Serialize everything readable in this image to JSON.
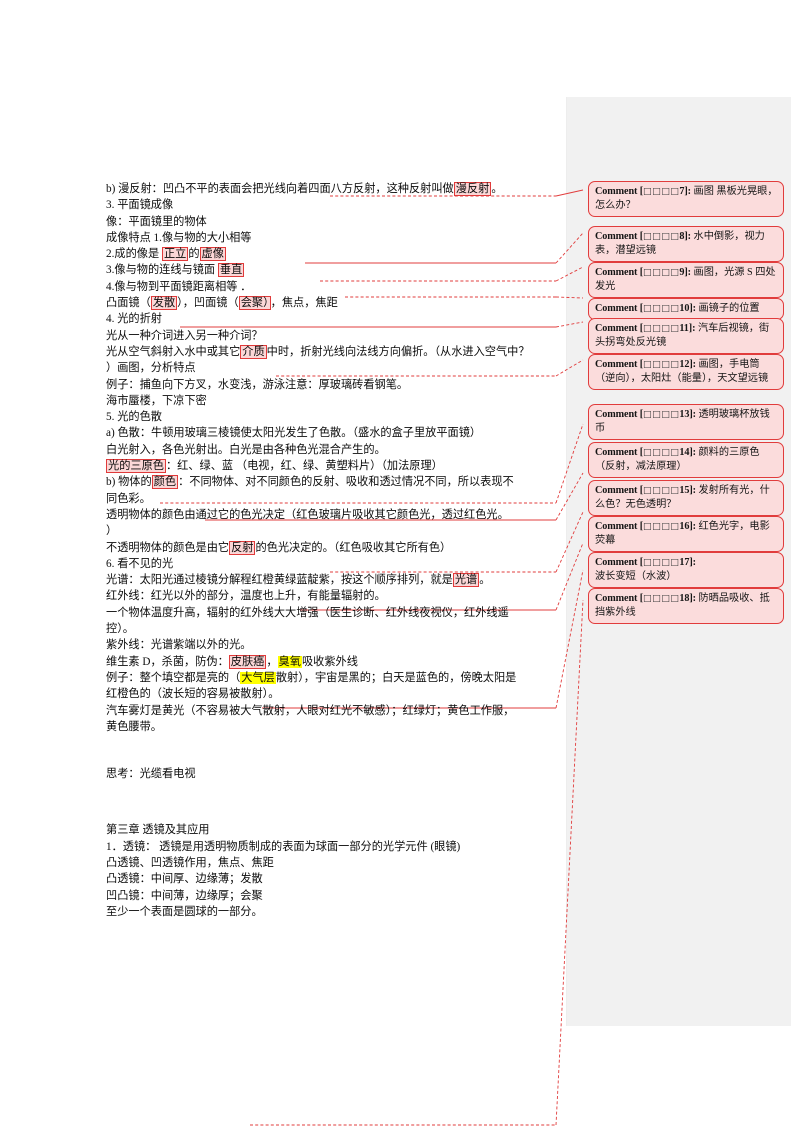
{
  "document": {
    "page_background": "#ffffff",
    "margin_panel_color": "#f1f1f1",
    "comment_fill": "#fbdcdc",
    "comment_border": "#e13c3c",
    "anchor_highlight_fill": "#fbd7d7",
    "yellow_highlight": "#ffff00"
  },
  "body": {
    "lines": [
      {
        "indent": 2,
        "text": "b)    漫反射：凹凸不平的表面会把光线向着四面八方反射，这种反射叫做",
        "hl": "漫反射",
        "tail": "。"
      },
      {
        "indent": 1,
        "text": "3.    平面镜成像"
      },
      {
        "indent": 3,
        "text": "像：平面镜里的物体"
      },
      {
        "indent": 1,
        "text": " 成像特点 1.像与物的大小相等"
      },
      {
        "indent": 4,
        "text": "2.成的像是 ",
        "hl": "正立",
        "mid": "的",
        "hl2": "虚像"
      },
      {
        "indent": 5,
        "text": "3.像与物的连线与镜面 ",
        "hl": "垂直"
      },
      {
        "indent": 5,
        "text": "4.像与物到平面镜距离相等 ．"
      },
      {
        "indent": 3,
        "text": "凸面镜（",
        "hl": "发散",
        "mid": "），凹面镜（",
        "hl2": "会聚）",
        "tail": "，焦点，焦距"
      },
      {
        "indent": 1,
        "text": "4.    光的折射"
      },
      {
        "indent": 3,
        "text": "光从一种介词进入另一种介词？"
      },
      {
        "indent": 3,
        "text": "光从空气斜射入水中或其它",
        "hl": "介质",
        "tail": "中时，折射光线向法线方向偏折。（从水进入空气中？"
      },
      {
        "indent": 3,
        "text": "）画图，分析特点"
      },
      {
        "indent": 1,
        "text": "例子：捕鱼向下方叉，水变浅，游泳注意：厚玻璃砖看钢笔。"
      },
      {
        "indent": 1,
        "text": "海市蜃楼，下凉下密"
      },
      {
        "indent": 1,
        "text": "5.    光的色散"
      },
      {
        "indent": 2,
        "text": "a)    色散：牛顿用玻璃三棱镜使太阳光发生了色散。（盛水的盒子里放平面镜）"
      },
      {
        "indent": 3,
        "text": "白光射入，各色光射出。白光是由各种色光混合产生的。"
      },
      {
        "indent": 3,
        "text": "",
        "hl": "光的三原色",
        "tail": "：红、绿、蓝 （电视，红、绿、黄塑料片）（加法原理）"
      },
      {
        "indent": 2,
        "text": "b)    物体的",
        "hl": "颜色",
        "tail": "：不同物体、对不同颜色的反射、吸收和透过情况不同，所以表现不"
      },
      {
        "indent": 3,
        "text": "同色彩。"
      },
      {
        "indent": 3,
        "text": "透明物体的颜色由通过它的色光决定（红色玻璃片吸收其它颜色光，透过红色光。"
      },
      {
        "indent": 3,
        "text": "）"
      },
      {
        "indent": 3,
        "text": "不透明物体的颜色是由它",
        "hl": "反射",
        "tail": "的色光决定的。（红色吸收其它所有色）"
      },
      {
        "indent": 1,
        "text": "6.    看不见的光"
      },
      {
        "indent": 3,
        "text": "光谱：太阳光通过棱镜分解程红橙黄绿蓝靛紫，按这个顺序排列，就是",
        "hl": "光谱",
        "tail": "。"
      },
      {
        "indent": 3,
        "text": "红外线：红光以外的部分，温度也上升，有能量辐射的。"
      },
      {
        "indent": 3,
        "text": "一个物体温度升高，辐射的红外线大大增强（医生诊断、红外线夜视仪，红外线遥"
      },
      {
        "indent": 3,
        "text": "控）。"
      },
      {
        "indent": 3,
        "text": "紫外线：光谱紫端以外的光。"
      },
      {
        "indent": 3,
        "text": "维生素 D，杀菌，防伪：",
        "hl": "皮肤癌",
        "mid": "，",
        "hly": "臭氧",
        "tail": "吸收紫外线"
      },
      {
        "indent": 3,
        "text": "例子：整个填空都是亮的（",
        "hly": "大气层",
        "tail": "散射），宇宙是黑的；白天是蓝色的，傍晚太阳是"
      },
      {
        "indent": 3,
        "text": "红橙色的（波长短的容易被散射）。"
      },
      {
        "indent": 3,
        "text": "汽车雾灯是黄光（不容易被大气散射，人眼对红光不敏感）；红绿灯；黄色工作服，"
      },
      {
        "indent": 3,
        "text": "黄色腰带。"
      },
      {
        "indent": 1,
        "text": "思考：光缆看电视"
      },
      {
        "indent": 1,
        "text": "第三章   透镜及其应用"
      },
      {
        "indent": 1,
        "text": "1．透镜：  透镜是用透明物质制成的表面为球面一部分的光学元件  (眼镜)"
      },
      {
        "indent": 3,
        "text": "凸透镜、凹透镜作用，焦点、焦距"
      },
      {
        "indent": 3,
        "text": "凸透镜：中间厚、边缘薄；发散"
      },
      {
        "indent": 3,
        "text": "凹凸镜：中间薄，边缘厚；会聚"
      },
      {
        "indent": 3,
        "text": "至少一个表面是圆球的一部分。"
      }
    ]
  },
  "comments": [
    {
      "id": 7,
      "label": "Comment [",
      "boxes": "□□□□",
      "num": "7]:",
      "text": "画图\n黑板光晃眼，怎么办？"
    },
    {
      "id": 8,
      "label": "Comment [",
      "boxes": "□□□□",
      "num": "8]:",
      "text": "水中倒影，视力表，潜望远镜"
    },
    {
      "id": 9,
      "label": "Comment [",
      "boxes": "□□□□",
      "num": "9]:",
      "text": "画图，光源 S 四处发光"
    },
    {
      "id": 10,
      "label": "Comment [",
      "boxes": "□□□□",
      "num": "10]:",
      "text": "画镜子的位置"
    },
    {
      "id": 11,
      "label": "Comment [",
      "boxes": "□□□□",
      "num": "11]:",
      "text": "汽车后视镜，街头拐弯处反光镜"
    },
    {
      "id": 12,
      "label": "Comment [",
      "boxes": "□□□□",
      "num": "12]:",
      "text": "画图，手电筒（逆向），太阳灶（能量），天文望远镜"
    },
    {
      "id": 13,
      "label": "Comment [",
      "boxes": "□□□□",
      "num": "13]:",
      "text": "透明玻璃杯放钱币"
    },
    {
      "id": 14,
      "label": "Comment [",
      "boxes": "□□□□",
      "num": "14]:",
      "text": "颜料的三原色（反射，减法原理）"
    },
    {
      "id": 15,
      "label": "Comment [",
      "boxes": "□□□□",
      "num": "15]:",
      "text": "发射所有光，什么色？无色透明？"
    },
    {
      "id": 16,
      "label": "Comment [",
      "boxes": "□□□□",
      "num": "16]:",
      "text": "红色光字，电影荧幕"
    },
    {
      "id": 17,
      "label": "Comment [",
      "boxes": "□□□□",
      "num": "17]:",
      "text": "波长变短（水波）"
    },
    {
      "id": 18,
      "label": "Comment [",
      "boxes": "□□□□",
      "num": "18]:",
      "text": "防晒品吸收、抵挡紫外线"
    }
  ]
}
